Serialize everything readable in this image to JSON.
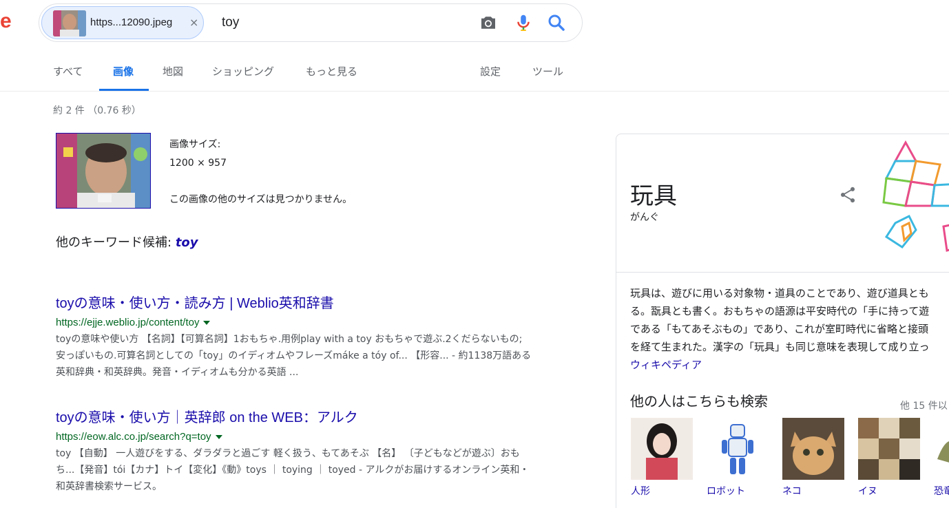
{
  "logo": {
    "fragment": "e"
  },
  "search": {
    "chip_label": "https...12090.jpeg",
    "chip_close": "×",
    "query": "toy"
  },
  "tabs": [
    {
      "label": "すべて"
    },
    {
      "label": "画像"
    },
    {
      "label": "地図"
    },
    {
      "label": "ショッピング"
    },
    {
      "label": "もっと見る"
    },
    {
      "label": "設定"
    },
    {
      "label": "ツール"
    }
  ],
  "stats": "約 2 件 （0.76 秒）",
  "image_info": {
    "size_label": "画像サイズ:",
    "size_value": "1200 × 957",
    "note": "この画像の他のサイズは見つかりません。"
  },
  "keyword": {
    "prefix": "他のキーワード候補:",
    "term": "toy"
  },
  "results": [
    {
      "title": "toyの意味・使い方・読み方 | Weblio英和辞書",
      "url": "https://ejje.weblio.jp/content/toy",
      "snippet": [
        "toyの意味や使い方 【名詞】【可算名詞】1おもちゃ.用例play with a toy おもちゃで遊ぶ.2くだらないもの;",
        "安っぽいもの.可算名詞としての「toy」のイディオムやフレーズmáke a tóy of... 【形容... - 約1138万語ある",
        "英和辞典・和英辞典。発音・イディオムも分かる英語 ..."
      ]
    },
    {
      "title": "toyの意味・使い方｜英辞郎 on the WEB：アルク",
      "url": "https://eow.alc.co.jp/search?q=toy",
      "snippet": [
        "toy 【自動】 一人遊びをする、ダラダラと過ごす 軽く扱う、もてあそぶ 【名】 〔子どもなどが遊ぶ〕おも",
        "ち...【発音】tói【カナ】トイ【変化】《動》toys ｜ toying ｜ toyed - アルクがお届けするオンライン英和・",
        "和英辞書検索サービス。"
      ]
    }
  ],
  "knowledge_panel": {
    "title": "玩具",
    "reading": "がんぐ",
    "description": [
      "玩具は、遊びに用いる対象物・道具のことであり、遊び道具とも",
      "る。翫具とも書く。おもちゃの語源は平安時代の「手に持って遊",
      "である「もてあそぶもの」であり、これが室町時代に省略と接頭",
      "を経て生まれた。漢字の「玩具」も同じ意味を表現して成り立っ"
    ],
    "source": "ウィキペディア",
    "also_search_title": "他の人はこちらも検索",
    "also_search_more": "他 15 件以",
    "also_search": [
      {
        "label": "人形"
      },
      {
        "label": "ロボット"
      },
      {
        "label": "ネコ"
      },
      {
        "label": "イヌ"
      },
      {
        "label": "恐竜"
      }
    ]
  },
  "colors": {
    "link": "#1a0dab",
    "url_green": "#006621",
    "accent_blue": "#1a73e8",
    "logo_red": "#ea4335"
  }
}
